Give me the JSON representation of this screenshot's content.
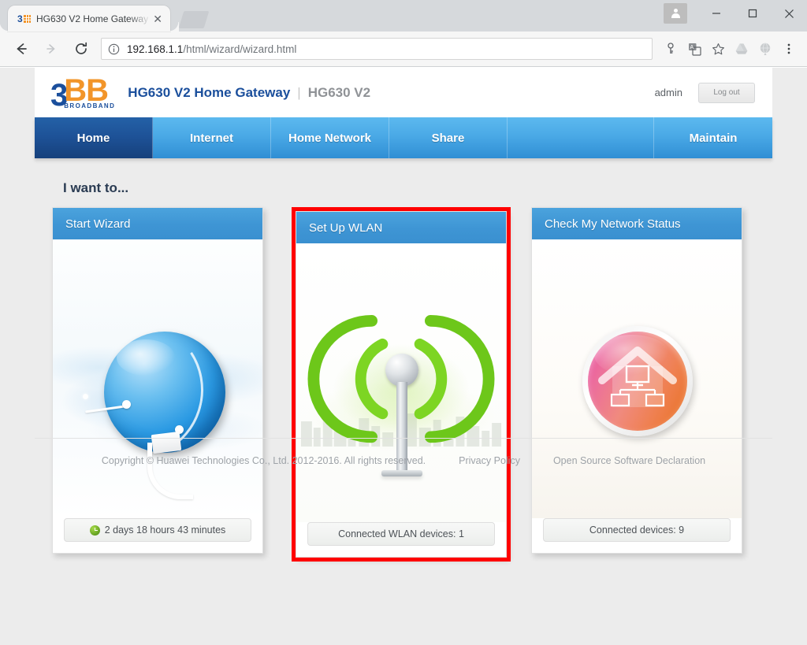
{
  "browser": {
    "tab": {
      "title": "HG630 V2 Home Gateway",
      "favicon_name": "3bb-favicon",
      "close_label": "✕"
    },
    "newtab_label": "",
    "window_controls": {
      "profile": "profile-avatar",
      "minimize": "—",
      "maximize": "□",
      "close": "✕"
    },
    "toolbar": {
      "back_label": "←",
      "forward_label": "→",
      "reload_label": "C",
      "site_info_label": "ⓘ",
      "url_host": "192.168.1.1",
      "url_path": "/html/wizard/wizard.html",
      "icons": [
        "password-key-icon",
        "translate-icon",
        "bookmark-star-icon",
        "drive-icon",
        "globe-icon",
        "chrome-menu-icon"
      ]
    }
  },
  "header": {
    "logo": {
      "three": "3",
      "bb": "BB",
      "broadband": "BROADBAND"
    },
    "product_title": "HG630 V2 Home Gateway",
    "separator": "|",
    "model": "HG630 V2",
    "user": "admin",
    "logout_label": "Log out"
  },
  "nav": {
    "items": [
      {
        "label": "Home",
        "active": true
      },
      {
        "label": "Internet",
        "active": false
      },
      {
        "label": "Home Network",
        "active": false
      },
      {
        "label": "Share",
        "active": false
      },
      {
        "label": "",
        "active": false
      },
      {
        "label": "Maintain",
        "active": false
      }
    ]
  },
  "main": {
    "section_title": "I want to...",
    "highlight_color": "#ff0000",
    "cards": [
      {
        "title": "Start Wizard",
        "icon_name": "globe-network-icon",
        "status": "2 days 18 hours 43 minutes",
        "status_icon": "green-clock-icon",
        "highlighted": false
      },
      {
        "title": "Set Up WLAN",
        "icon_name": "wifi-antenna-icon",
        "status": "Connected WLAN devices: 1",
        "status_icon": "",
        "highlighted": true
      },
      {
        "title": "Check My Network Status",
        "icon_name": "home-network-icon",
        "status": "Connected devices: 9",
        "status_icon": "",
        "highlighted": false
      }
    ]
  },
  "footer": {
    "copyright": "Copyright © Huawei Technologies Co., Ltd. 2012-2016. All rights reserved.",
    "privacy_policy": "Privacy Policy",
    "open_source": "Open Source Software Declaration"
  }
}
